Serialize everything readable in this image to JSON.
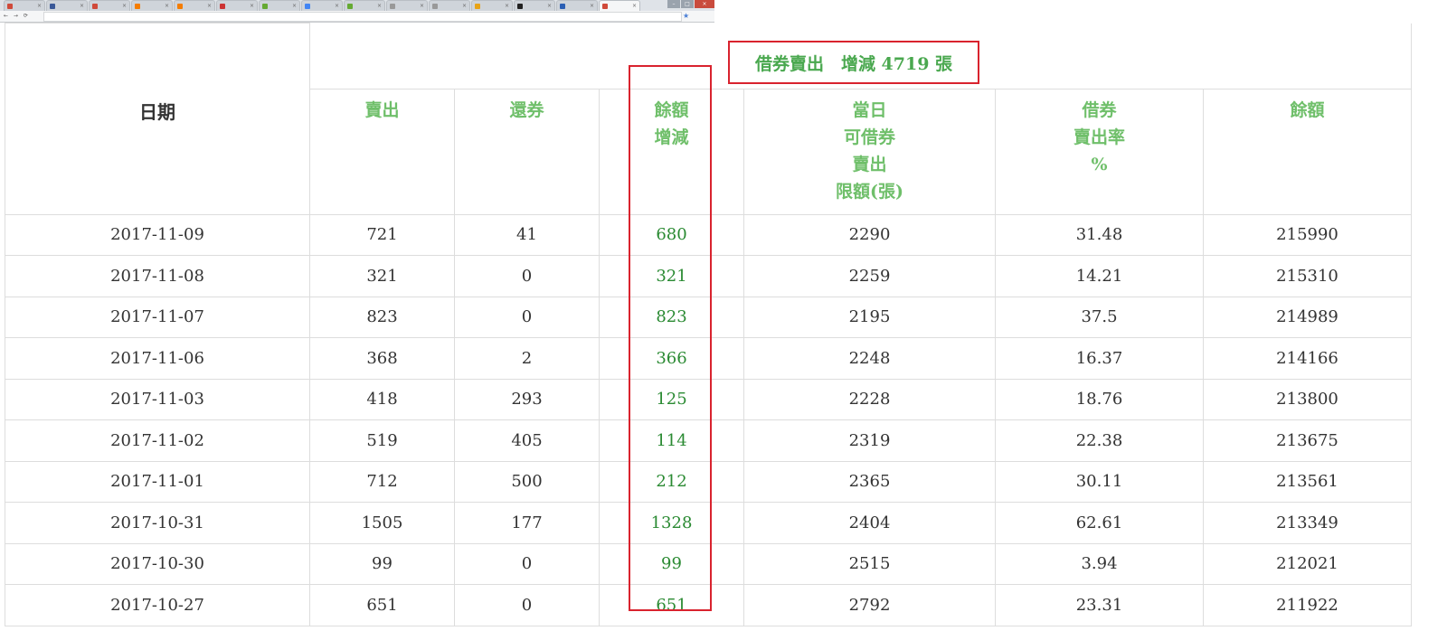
{
  "header": {
    "banner": "借券賣出　增減 4719 張",
    "col_date": "日期",
    "col_sell": "賣出",
    "col_return": "還券",
    "col_change": [
      "餘額",
      "增減"
    ],
    "col_limit": [
      "當日",
      "可借券",
      "賣出",
      "限額(張)"
    ],
    "col_rate": [
      "借券",
      "賣出率",
      "%"
    ],
    "col_balance": "餘額"
  },
  "rows": [
    {
      "date": "2017-11-09",
      "sell": "721",
      "return": "41",
      "change": "680",
      "limit": "2290",
      "rate": "31.48",
      "balance": "215990"
    },
    {
      "date": "2017-11-08",
      "sell": "321",
      "return": "0",
      "change": "321",
      "limit": "2259",
      "rate": "14.21",
      "balance": "215310"
    },
    {
      "date": "2017-11-07",
      "sell": "823",
      "return": "0",
      "change": "823",
      "limit": "2195",
      "rate": "37.5",
      "balance": "214989"
    },
    {
      "date": "2017-11-06",
      "sell": "368",
      "return": "2",
      "change": "366",
      "limit": "2248",
      "rate": "16.37",
      "balance": "214166"
    },
    {
      "date": "2017-11-03",
      "sell": "418",
      "return": "293",
      "change": "125",
      "limit": "2228",
      "rate": "18.76",
      "balance": "213800"
    },
    {
      "date": "2017-11-02",
      "sell": "519",
      "return": "405",
      "change": "114",
      "limit": "2319",
      "rate": "22.38",
      "balance": "213675"
    },
    {
      "date": "2017-11-01",
      "sell": "712",
      "return": "500",
      "change": "212",
      "limit": "2365",
      "rate": "30.11",
      "balance": "213561"
    },
    {
      "date": "2017-10-31",
      "sell": "1505",
      "return": "177",
      "change": "1328",
      "limit": "2404",
      "rate": "62.61",
      "balance": "213349"
    },
    {
      "date": "2017-10-30",
      "sell": "99",
      "return": "0",
      "change": "99",
      "limit": "2515",
      "rate": "3.94",
      "balance": "212021"
    },
    {
      "date": "2017-10-27",
      "sell": "651",
      "return": "0",
      "change": "651",
      "limit": "2792",
      "rate": "23.31",
      "balance": "211922"
    }
  ],
  "colors": {
    "green_header": "#6fbf6a",
    "green_value": "#2a8a32",
    "highlight_red": "#d9232e"
  }
}
